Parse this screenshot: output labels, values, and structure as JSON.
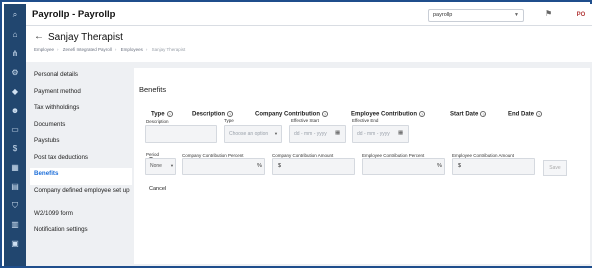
{
  "app": {
    "title": "Payrollp - Payrollp"
  },
  "topbar": {
    "company": "payrollp",
    "avatar_initials": "PO"
  },
  "header": {
    "title": "Sanjay Therapist",
    "breadcrumb": [
      "Employee",
      "Zenefi Integrated Payroll",
      "Employees",
      "Sanjay Therapist"
    ]
  },
  "sidebar": {
    "items": [
      {
        "label": "Personal details",
        "active": false
      },
      {
        "label": "Payment method",
        "active": false
      },
      {
        "label": "Tax withholdings",
        "active": false
      },
      {
        "label": "Documents",
        "active": false
      },
      {
        "label": "Paystubs",
        "active": false
      },
      {
        "label": "Post tax deductions",
        "active": false
      },
      {
        "label": "Benefits",
        "active": true
      },
      {
        "label": "Company defined employee set up",
        "active": false
      },
      {
        "label": "W2/1099 form",
        "active": false
      },
      {
        "label": "Notification settings",
        "active": false
      }
    ]
  },
  "benefits": {
    "title": "Benefits",
    "columns": {
      "type": "Type",
      "description": "Description",
      "company_contribution": "Company Contribution",
      "employee_contribution": "Employee Contribution",
      "start_date": "Start Date",
      "end_date": "End Date"
    },
    "sublabels": {
      "description": "Description",
      "type": "Type",
      "effective_start": "Effective Start",
      "effective_end": "Effective End",
      "period": "Period",
      "company_percent": "Company Contribution Percent",
      "company_amount": "Company Contribution Amount",
      "employee_percent": "Employee Contribution Percent",
      "employee_amount": "Employee Contribution Amount"
    },
    "type_placeholder": "Choose an option",
    "date_placeholder": "dd - mm - yyyy",
    "period_value": "None",
    "percent_suffix": "%",
    "currency_prefix": "$",
    "save_label": "Save",
    "cancel_label": "Cancel"
  }
}
